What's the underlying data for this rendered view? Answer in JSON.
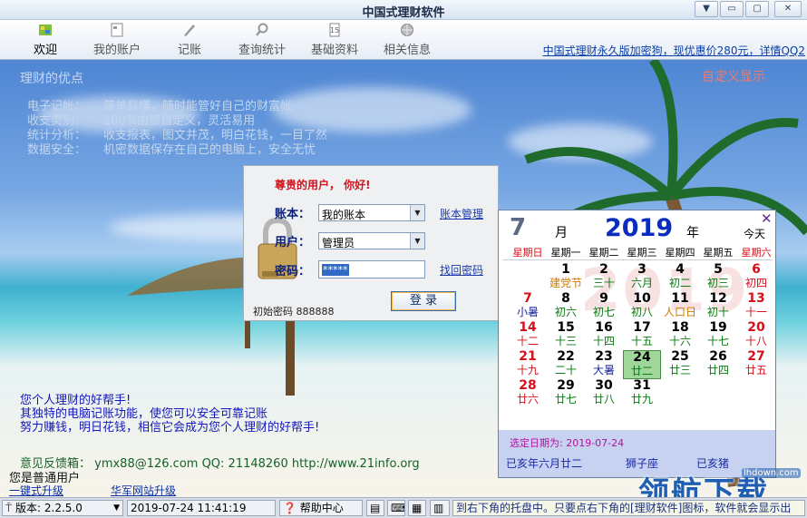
{
  "window": {
    "title": "中国式理财软件",
    "controls": [
      "▼",
      "▭",
      "▢",
      "✕"
    ]
  },
  "toolbar": {
    "items": [
      {
        "label": "欢迎",
        "icon": "welcome-icon"
      },
      {
        "label": "我的账户",
        "icon": "account-icon"
      },
      {
        "label": "记账",
        "icon": "pen-icon"
      },
      {
        "label": "查询统计",
        "icon": "search-icon"
      },
      {
        "label": "基础资料",
        "icon": "book-icon"
      },
      {
        "label": "相关信息",
        "icon": "globe-icon"
      }
    ],
    "promo": "中国式理财永久版加密狗，现优惠价280元，详情QQ2"
  },
  "advantages": {
    "title": "理财的优点",
    "custom_show": "自定义显示",
    "items": [
      {
        "key": "电子记帐：",
        "text": "简单易懂，随时能管好自己的财富帐"
      },
      {
        "key": "收支类别：",
        "text": "100%由您自定义，灵活易用"
      },
      {
        "key": "统计分析：",
        "text": "收支报表，图文并茂，明白花钱，一目了然"
      },
      {
        "key": "数据安全：",
        "text": "机密数据保存在自己的电脑上，安全无忧"
      }
    ]
  },
  "login": {
    "greeting": "尊贵的用户，  你好!",
    "account_label": "账本：",
    "account_value": "我的账本",
    "account_link": "账本管理",
    "user_label": "用户：",
    "user_value": "管理员",
    "password_label": "密码：",
    "password_value": "*****",
    "password_link": "找回密码",
    "login_button": "登  录",
    "initial_password": "初始密码 888888"
  },
  "calendar": {
    "month": "7",
    "month_text": "月",
    "year": "2019",
    "year_text": "年",
    "today": "今天",
    "close": "✕",
    "watermark": "2019",
    "weekdays": [
      "星期日",
      "星期一",
      "星期二",
      "星期三",
      "星期四",
      "星期五",
      "星期六"
    ],
    "weekday_colors": [
      "#d4101a",
      "#000000",
      "#000000",
      "#000000",
      "#000000",
      "#000000",
      "#d4101a"
    ],
    "first_weekday": 1,
    "selected_day": 24,
    "days": [
      {
        "d": "1",
        "l": "建党节",
        "lc": "#d07a00"
      },
      {
        "d": "2",
        "l": "三十",
        "lc": "#0a7a12"
      },
      {
        "d": "3",
        "l": "六月",
        "lc": "#0a7a12"
      },
      {
        "d": "4",
        "l": "初二",
        "lc": "#0a7a12"
      },
      {
        "d": "5",
        "l": "初三",
        "lc": "#0a7a12"
      },
      {
        "d": "6",
        "l": "初四",
        "lc": "#d4101a"
      },
      {
        "d": "7",
        "l": "小暑",
        "lc": "#1b2aa8"
      },
      {
        "d": "8",
        "l": "初六",
        "lc": "#0a7a12"
      },
      {
        "d": "9",
        "l": "初七",
        "lc": "#0a7a12"
      },
      {
        "d": "10",
        "l": "初八",
        "lc": "#0a7a12"
      },
      {
        "d": "11",
        "l": "人口日",
        "lc": "#d07a00"
      },
      {
        "d": "12",
        "l": "初十",
        "lc": "#0a7a12"
      },
      {
        "d": "13",
        "l": "十一",
        "lc": "#d4101a"
      },
      {
        "d": "14",
        "l": "十二",
        "lc": "#d4101a"
      },
      {
        "d": "15",
        "l": "十三",
        "lc": "#0a7a12"
      },
      {
        "d": "16",
        "l": "十四",
        "lc": "#0a7a12"
      },
      {
        "d": "17",
        "l": "十五",
        "lc": "#0a7a12"
      },
      {
        "d": "18",
        "l": "十六",
        "lc": "#0a7a12"
      },
      {
        "d": "19",
        "l": "十七",
        "lc": "#0a7a12"
      },
      {
        "d": "20",
        "l": "十八",
        "lc": "#d4101a"
      },
      {
        "d": "21",
        "l": "十九",
        "lc": "#d4101a"
      },
      {
        "d": "22",
        "l": "二十",
        "lc": "#0a7a12"
      },
      {
        "d": "23",
        "l": "大暑",
        "lc": "#1b2aa8"
      },
      {
        "d": "24",
        "l": "廿二",
        "lc": "#0a7a12"
      },
      {
        "d": "25",
        "l": "廿三",
        "lc": "#0a7a12"
      },
      {
        "d": "26",
        "l": "廿四",
        "lc": "#0a7a12"
      },
      {
        "d": "27",
        "l": "廿五",
        "lc": "#d4101a"
      },
      {
        "d": "28",
        "l": "廿六",
        "lc": "#d4101a"
      },
      {
        "d": "29",
        "l": "廿七",
        "lc": "#0a7a12"
      },
      {
        "d": "30",
        "l": "廿八",
        "lc": "#0a7a12"
      },
      {
        "d": "31",
        "l": "廿九",
        "lc": "#0a7a12"
      }
    ],
    "selected_date_text": "选定日期为: 2019-07-24",
    "lunar_text": "已亥年六月廿二",
    "zodiac_text": "狮子座",
    "year_animal": "已亥猪"
  },
  "welcome": {
    "lines": [
      "您个人理财的好帮手!",
      "其独特的电脑记账功能，使您可以安全可靠记账",
      "努力赚钱，明日花钱，相信它会成为您个人理财的好帮手!"
    ],
    "feedback": "意见反馈箱： ymx88@126.com  QQ: 21148260   http://www.21info.org",
    "user_status": "您是普通用户",
    "upgrade_link": "一键式升级",
    "site_upgrade_link": "华军网站升级"
  },
  "statusbar": {
    "version": "版本: 2.2.5.0",
    "datetime": "2019-07-24  11:41:19",
    "help": "帮助中心",
    "tip": "到右下角的托盘中。只要点右下角的[理财软件]图标，软件就会显示出"
  },
  "overlay_watermark": {
    "text": "领航下载",
    "site": "lhdown.com"
  }
}
